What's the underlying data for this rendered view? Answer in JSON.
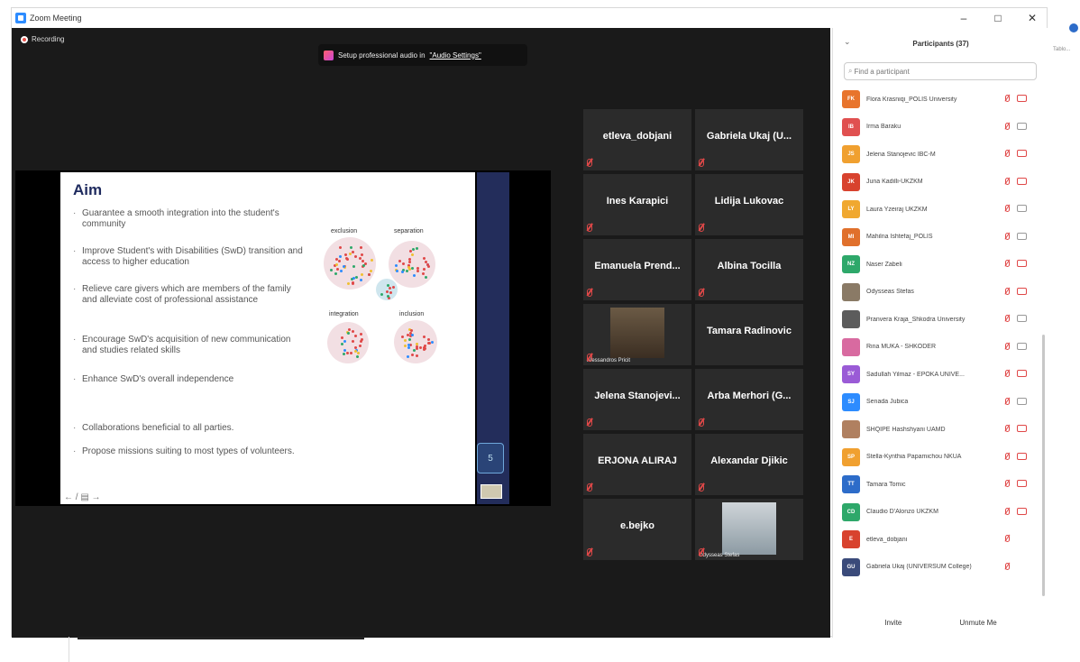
{
  "window": {
    "title": "Zoom Meeting",
    "controls": [
      "–",
      "□",
      "✕"
    ]
  },
  "stage": {
    "recording_label": "Recording",
    "audio_banner": {
      "text": "Setup professional audio in",
      "link": "\"Audio Settings\""
    }
  },
  "slide": {
    "title": "Aim",
    "bullets": [
      "Guarantee a smooth integration into the student's community",
      "Improve Student's with Disabilities (SwD) transition and access to higher education",
      "Relieve care givers which are members of the family and alleviate cost of professional assistance",
      "Encourage SwD's acquisition of new communication and studies related skills",
      "Enhance SwD's overall independence",
      "Collaborations beneficial to all parties.",
      "Propose missions suiting to most types of volunteers."
    ],
    "diagram_labels": [
      "exclusion",
      "separation",
      "integration",
      "inclusion"
    ],
    "nav": "← / ▤ →",
    "side_number": "5"
  },
  "gallery": [
    {
      "name": "etleva_dobjani"
    },
    {
      "name": "Gabriela Ukaj (U..."
    },
    {
      "name": "Ines Karapici"
    },
    {
      "name": "Lidija Lukovac"
    },
    {
      "name": "Emanuela Prend..."
    },
    {
      "name": "Albina Tocilla"
    },
    {
      "name": "",
      "caption": "Alessandros Pricit"
    },
    {
      "name": "Tamara Radinovic"
    },
    {
      "name": "Jelena Stanojevi..."
    },
    {
      "name": "Arba Merhori (G..."
    },
    {
      "name": "ERJONA ALIRAJ"
    },
    {
      "name": "Alexandar Djikic"
    },
    {
      "name": "e.bejko"
    },
    {
      "name": "",
      "caption": "Odysseas Stefas"
    }
  ],
  "panel": {
    "title": "Participants (37)",
    "search_placeholder": "Find a participant",
    "participants": [
      {
        "initials": "FK",
        "name": "Flora Krasniqi_POLIS University",
        "color": "#e8742c",
        "cam_on": false
      },
      {
        "initials": "IB",
        "name": "Irma Baraku",
        "color": "#e05050",
        "cam_on": true
      },
      {
        "initials": "JS",
        "name": "Jelena Stanojevic IBC-M",
        "color": "#f0a030",
        "cam_on": false
      },
      {
        "initials": "JK",
        "name": "Juna Kadilli-UKZKM",
        "color": "#d8422e",
        "cam_on": false
      },
      {
        "initials": "LY",
        "name": "Laura Yzeiraj UKZKM",
        "color": "#f0a830",
        "cam_on": true
      },
      {
        "initials": "MI",
        "name": "Mahilna Ishtefaj_POLIS",
        "color": "#e0702c",
        "cam_on": true
      },
      {
        "initials": "NZ",
        "name": "Naser Zabeli",
        "color": "#2ea86a",
        "cam_on": false
      },
      {
        "initials": "",
        "name": "Odysseas Stefas",
        "color": "#8a7a66",
        "cam_on": false
      },
      {
        "initials": "",
        "name": "Pranvera Kraja_Shkodra University",
        "color": "#5c5c5c",
        "cam_on": true
      },
      {
        "initials": "",
        "name": "Rina MUKA - SHKODER",
        "color": "#d86aa0",
        "cam_on": true
      },
      {
        "initials": "SY",
        "name": "Sadullah Yilmaz - EPOKA UNIVE...",
        "color": "#9a5bd6",
        "cam_on": false
      },
      {
        "initials": "SJ",
        "name": "Senada Jubica",
        "color": "#2d8cff",
        "cam_on": true
      },
      {
        "initials": "",
        "name": "SHQIPE Hashshyani UAMD",
        "color": "#b08060",
        "cam_on": false
      },
      {
        "initials": "SP",
        "name": "Stella-Kynthia Papamichou NKUA",
        "color": "#f0a030",
        "cam_on": false
      },
      {
        "initials": "TT",
        "name": "Tamara Tomic",
        "color": "#2d6cc9",
        "cam_on": false
      },
      {
        "initials": "CD",
        "name": "Claudio D'Alonzo UKZKM",
        "color": "#2ea86a",
        "cam_on": false
      },
      {
        "initials": "E",
        "name": "etleva_dobjani",
        "color": "#d8422e",
        "cam_on": null
      },
      {
        "initials": "GU",
        "name": "Gabriela Ukaj (UNIVERSUM College)",
        "color": "#3a4a7a",
        "cam_on": null
      }
    ],
    "buttons": {
      "invite": "Invite",
      "unmute": "Unmute Me"
    }
  },
  "edge": {
    "text": "Tablo..."
  }
}
